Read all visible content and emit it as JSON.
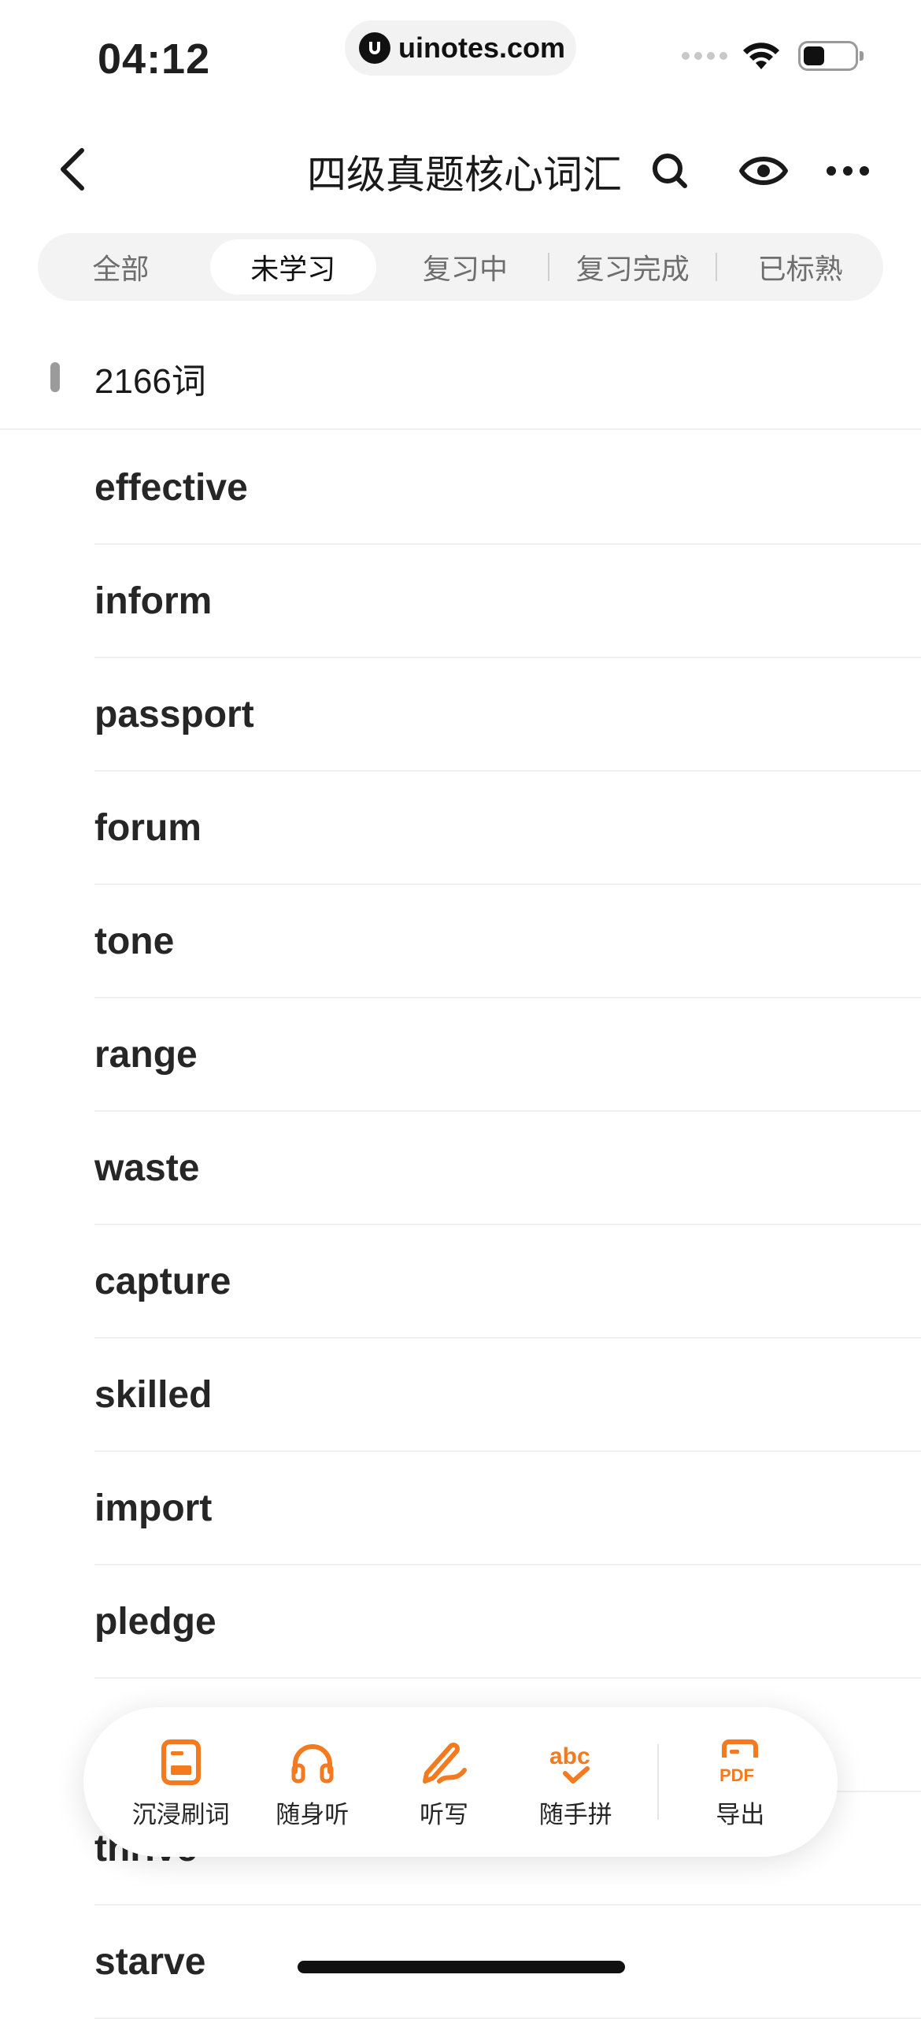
{
  "status_bar": {
    "time": "04:12",
    "url": "uinotes.com"
  },
  "navbar": {
    "title": "四级真题核心词汇"
  },
  "tabs": [
    {
      "label": "全部",
      "active": false
    },
    {
      "label": "未学习",
      "active": true
    },
    {
      "label": "复习中",
      "active": false
    },
    {
      "label": "复习完成",
      "active": false
    },
    {
      "label": "已标熟",
      "active": false
    }
  ],
  "count": {
    "label": "2166词"
  },
  "words": [
    "effective",
    "inform",
    "passport",
    "forum",
    "tone",
    "range",
    "waste",
    "capture",
    "skilled",
    "import",
    "pledge",
    "",
    "thrive",
    "starve"
  ],
  "actions": [
    {
      "label": "沉浸刷词",
      "icon": "document-icon"
    },
    {
      "label": "随身听",
      "icon": "headphones-icon"
    },
    {
      "label": "听写",
      "icon": "pen-write-icon"
    },
    {
      "label": "随手拼",
      "icon": "abc-spell-icon"
    },
    {
      "label": "导出",
      "icon": "pdf-export-icon"
    }
  ],
  "colors": {
    "accent": "#F47A1F",
    "text": "#262626",
    "muted": "#6E6E6E"
  }
}
